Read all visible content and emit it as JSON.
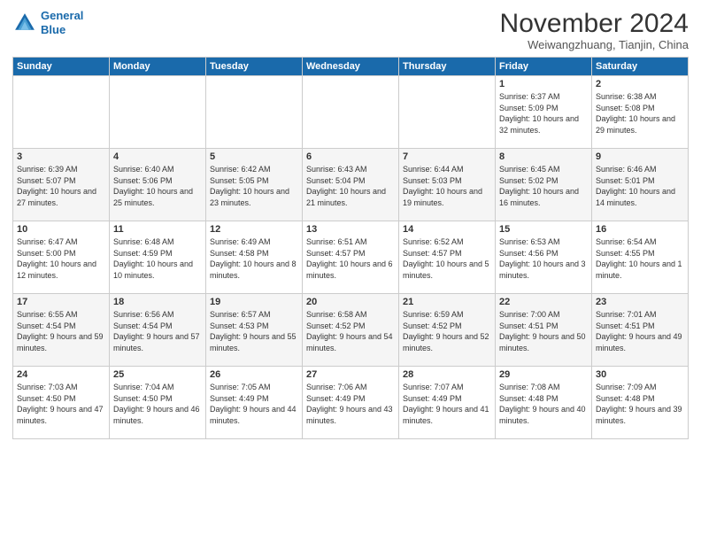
{
  "header": {
    "logo_line1": "General",
    "logo_line2": "Blue",
    "month_title": "November 2024",
    "location": "Weiwangzhuang, Tianjin, China"
  },
  "weekdays": [
    "Sunday",
    "Monday",
    "Tuesday",
    "Wednesday",
    "Thursday",
    "Friday",
    "Saturday"
  ],
  "weeks": [
    [
      {
        "day": "",
        "info": ""
      },
      {
        "day": "",
        "info": ""
      },
      {
        "day": "",
        "info": ""
      },
      {
        "day": "",
        "info": ""
      },
      {
        "day": "",
        "info": ""
      },
      {
        "day": "1",
        "info": "Sunrise: 6:37 AM\nSunset: 5:09 PM\nDaylight: 10 hours and 32 minutes."
      },
      {
        "day": "2",
        "info": "Sunrise: 6:38 AM\nSunset: 5:08 PM\nDaylight: 10 hours and 29 minutes."
      }
    ],
    [
      {
        "day": "3",
        "info": "Sunrise: 6:39 AM\nSunset: 5:07 PM\nDaylight: 10 hours and 27 minutes."
      },
      {
        "day": "4",
        "info": "Sunrise: 6:40 AM\nSunset: 5:06 PM\nDaylight: 10 hours and 25 minutes."
      },
      {
        "day": "5",
        "info": "Sunrise: 6:42 AM\nSunset: 5:05 PM\nDaylight: 10 hours and 23 minutes."
      },
      {
        "day": "6",
        "info": "Sunrise: 6:43 AM\nSunset: 5:04 PM\nDaylight: 10 hours and 21 minutes."
      },
      {
        "day": "7",
        "info": "Sunrise: 6:44 AM\nSunset: 5:03 PM\nDaylight: 10 hours and 19 minutes."
      },
      {
        "day": "8",
        "info": "Sunrise: 6:45 AM\nSunset: 5:02 PM\nDaylight: 10 hours and 16 minutes."
      },
      {
        "day": "9",
        "info": "Sunrise: 6:46 AM\nSunset: 5:01 PM\nDaylight: 10 hours and 14 minutes."
      }
    ],
    [
      {
        "day": "10",
        "info": "Sunrise: 6:47 AM\nSunset: 5:00 PM\nDaylight: 10 hours and 12 minutes."
      },
      {
        "day": "11",
        "info": "Sunrise: 6:48 AM\nSunset: 4:59 PM\nDaylight: 10 hours and 10 minutes."
      },
      {
        "day": "12",
        "info": "Sunrise: 6:49 AM\nSunset: 4:58 PM\nDaylight: 10 hours and 8 minutes."
      },
      {
        "day": "13",
        "info": "Sunrise: 6:51 AM\nSunset: 4:57 PM\nDaylight: 10 hours and 6 minutes."
      },
      {
        "day": "14",
        "info": "Sunrise: 6:52 AM\nSunset: 4:57 PM\nDaylight: 10 hours and 5 minutes."
      },
      {
        "day": "15",
        "info": "Sunrise: 6:53 AM\nSunset: 4:56 PM\nDaylight: 10 hours and 3 minutes."
      },
      {
        "day": "16",
        "info": "Sunrise: 6:54 AM\nSunset: 4:55 PM\nDaylight: 10 hours and 1 minute."
      }
    ],
    [
      {
        "day": "17",
        "info": "Sunrise: 6:55 AM\nSunset: 4:54 PM\nDaylight: 9 hours and 59 minutes."
      },
      {
        "day": "18",
        "info": "Sunrise: 6:56 AM\nSunset: 4:54 PM\nDaylight: 9 hours and 57 minutes."
      },
      {
        "day": "19",
        "info": "Sunrise: 6:57 AM\nSunset: 4:53 PM\nDaylight: 9 hours and 55 minutes."
      },
      {
        "day": "20",
        "info": "Sunrise: 6:58 AM\nSunset: 4:52 PM\nDaylight: 9 hours and 54 minutes."
      },
      {
        "day": "21",
        "info": "Sunrise: 6:59 AM\nSunset: 4:52 PM\nDaylight: 9 hours and 52 minutes."
      },
      {
        "day": "22",
        "info": "Sunrise: 7:00 AM\nSunset: 4:51 PM\nDaylight: 9 hours and 50 minutes."
      },
      {
        "day": "23",
        "info": "Sunrise: 7:01 AM\nSunset: 4:51 PM\nDaylight: 9 hours and 49 minutes."
      }
    ],
    [
      {
        "day": "24",
        "info": "Sunrise: 7:03 AM\nSunset: 4:50 PM\nDaylight: 9 hours and 47 minutes."
      },
      {
        "day": "25",
        "info": "Sunrise: 7:04 AM\nSunset: 4:50 PM\nDaylight: 9 hours and 46 minutes."
      },
      {
        "day": "26",
        "info": "Sunrise: 7:05 AM\nSunset: 4:49 PM\nDaylight: 9 hours and 44 minutes."
      },
      {
        "day": "27",
        "info": "Sunrise: 7:06 AM\nSunset: 4:49 PM\nDaylight: 9 hours and 43 minutes."
      },
      {
        "day": "28",
        "info": "Sunrise: 7:07 AM\nSunset: 4:49 PM\nDaylight: 9 hours and 41 minutes."
      },
      {
        "day": "29",
        "info": "Sunrise: 7:08 AM\nSunset: 4:48 PM\nDaylight: 9 hours and 40 minutes."
      },
      {
        "day": "30",
        "info": "Sunrise: 7:09 AM\nSunset: 4:48 PM\nDaylight: 9 hours and 39 minutes."
      }
    ]
  ]
}
